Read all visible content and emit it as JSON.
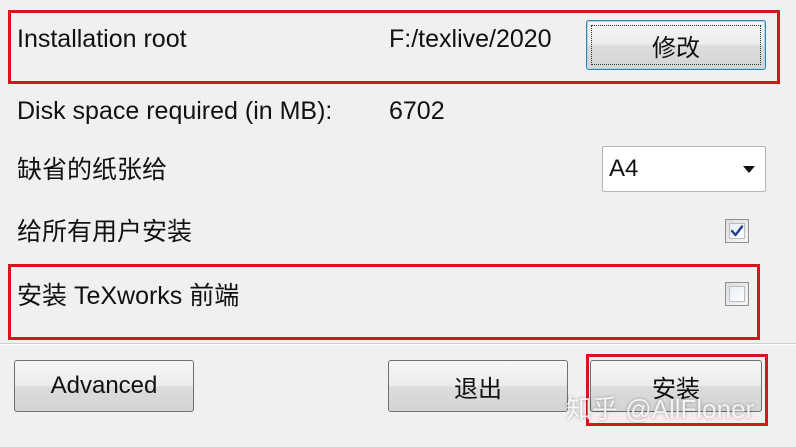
{
  "installation": {
    "label": "Installation root",
    "path": "F:/texlive/2020",
    "modify_button": "修改"
  },
  "disk_space": {
    "label": "Disk space required (in MB):",
    "value": "6702"
  },
  "paper": {
    "label": "缺省的纸张给",
    "selected": "A4"
  },
  "all_users": {
    "label": "给所有用户安装",
    "checked": true
  },
  "texworks": {
    "label": "安装 TeXworks 前端",
    "checked": false
  },
  "buttons": {
    "advanced": "Advanced",
    "quit": "退出",
    "install": "安装"
  },
  "watermark": "知乎 @AllFloner",
  "colors": {
    "highlight": "#d8151d",
    "background": "#f0f0f0",
    "check_mark": "#1e3f8a"
  },
  "icons": {
    "dropdown": "chevron-down-icon",
    "check": "checkmark-icon"
  }
}
